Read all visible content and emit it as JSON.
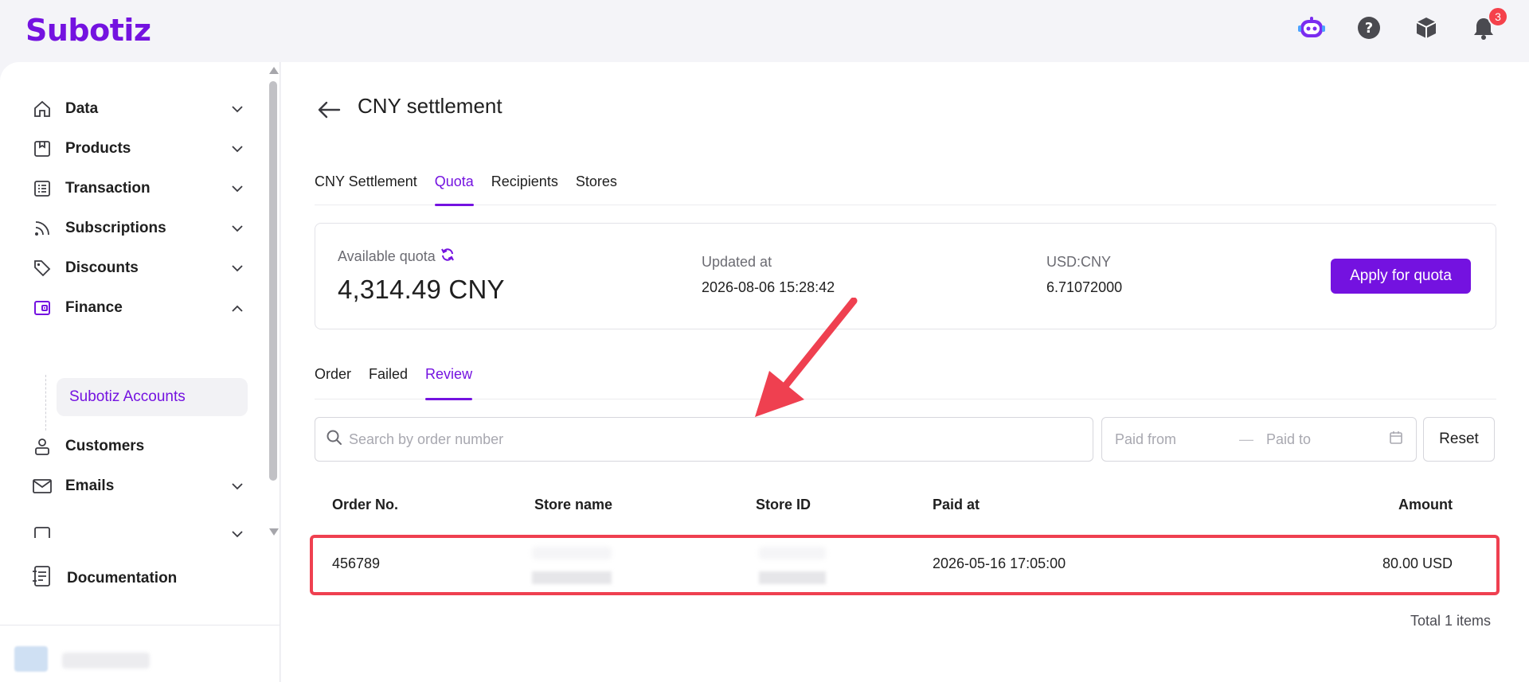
{
  "app": {
    "logo": "Subotiz"
  },
  "topbar": {
    "icons": [
      "robot-assistant-icon",
      "help-icon",
      "package-icon",
      "bell-icon"
    ],
    "notification_count": "3"
  },
  "sidebar": {
    "items": [
      {
        "label": "Data",
        "icon": "home-icon",
        "expanded": false
      },
      {
        "label": "Products",
        "icon": "products-icon",
        "expanded": false
      },
      {
        "label": "Transaction",
        "icon": "list-icon",
        "expanded": false
      },
      {
        "label": "Subscriptions",
        "icon": "rss-icon",
        "expanded": false
      },
      {
        "label": "Discounts",
        "icon": "tag-icon",
        "expanded": false
      },
      {
        "label": "Finance",
        "icon": "wallet-icon",
        "expanded": true
      },
      {
        "label": "Customers",
        "icon": "user-icon",
        "expanded": false
      },
      {
        "label": "Emails",
        "icon": "mail-icon",
        "expanded": false
      }
    ],
    "finance_sub": {
      "label": "Subotiz Accounts"
    },
    "documentation": {
      "label": "Documentation",
      "icon": "document-icon"
    }
  },
  "page": {
    "title": "CNY settlement",
    "tabs": [
      "CNY Settlement",
      "Quota",
      "Recipients",
      "Stores"
    ],
    "active_tab": "Quota"
  },
  "quota": {
    "available_label": "Available quota",
    "available_value": "4,314.49 CNY",
    "updated_label": "Updated at",
    "updated_value": "2026-08-06 15:28:42",
    "rate_label": "USD:CNY",
    "rate_value": "6.71072000",
    "apply_label": "Apply for quota"
  },
  "subtabs": {
    "items": [
      "Order",
      "Failed",
      "Review"
    ],
    "active": "Review"
  },
  "filters": {
    "search_placeholder": "Search by order number",
    "paid_from_placeholder": "Paid from",
    "separator": "—",
    "paid_to_placeholder": "Paid to",
    "reset_label": "Reset"
  },
  "table": {
    "columns": [
      "Order No.",
      "Store name",
      "Store ID",
      "Paid at",
      "Amount"
    ],
    "rows": [
      {
        "order_no": "456789",
        "store_name": "",
        "store_id": "",
        "paid_at": "2026-05-16 17:05:00",
        "amount": "80.00 USD"
      }
    ],
    "total": "Total 1 items"
  },
  "colors": {
    "accent": "#7412e0",
    "highlight": "#ef4050",
    "badge": "#f5414b"
  }
}
